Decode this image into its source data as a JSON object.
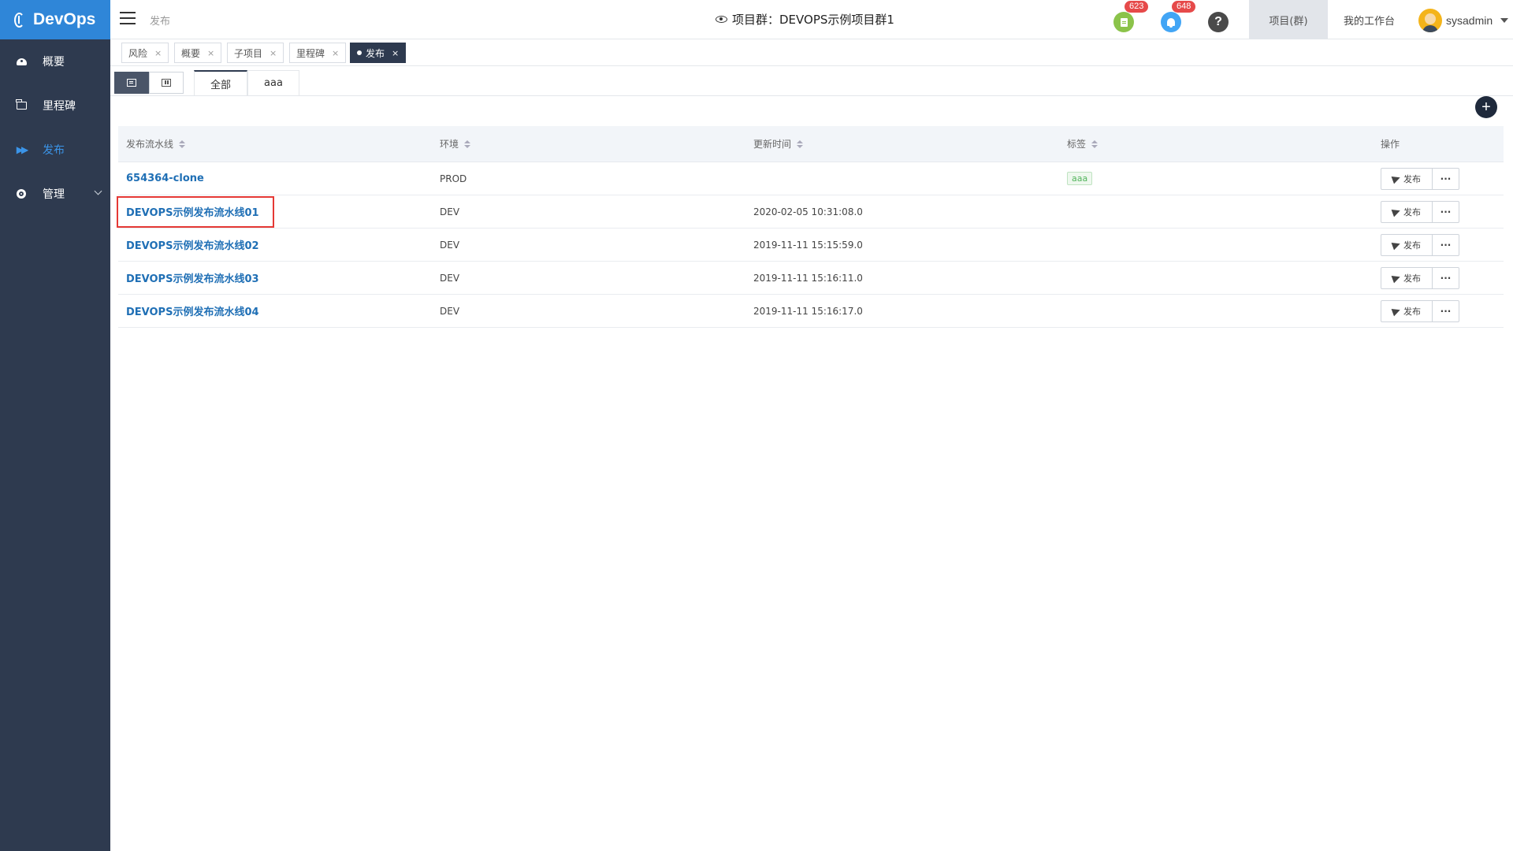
{
  "app": {
    "name": "DevOps"
  },
  "sidebar": {
    "items": [
      {
        "label": "概要",
        "icon": "dashboard-icon",
        "active": false
      },
      {
        "label": "里程碑",
        "icon": "folder-icon",
        "active": false
      },
      {
        "label": "发布",
        "icon": "fast-forward-icon",
        "active": true
      },
      {
        "label": "管理",
        "icon": "gear-icon",
        "active": false,
        "expandable": true
      }
    ]
  },
  "header": {
    "breadcrumb": "发布",
    "title": "项目群：DEVOPS示例项目群1",
    "doc_badge": "623",
    "bell_badge": "648",
    "help": "?",
    "project_group_label": "项目(群)",
    "workbench_label": "我的工作台",
    "user_name": "sysadmin"
  },
  "tabs": [
    {
      "label": "风险",
      "close": "×",
      "active": false
    },
    {
      "label": "概要",
      "close": "×",
      "active": false
    },
    {
      "label": "子项目",
      "close": "×",
      "active": false
    },
    {
      "label": "里程碑",
      "close": "×",
      "active": false
    },
    {
      "label": "发布",
      "close": "×",
      "active": true
    }
  ],
  "filter_tabs": [
    {
      "label": "全部",
      "active": true
    },
    {
      "label": "aaa",
      "active": false
    }
  ],
  "add_button": "+",
  "table": {
    "columns": [
      "发布流水线",
      "环境",
      "更新时间",
      "标签",
      "操作"
    ],
    "rows": [
      {
        "name": "654364-clone",
        "env": "PROD",
        "updated": "",
        "tag": "aaa"
      },
      {
        "name": "DEVOPS示例发布流水线01",
        "env": "DEV",
        "updated": "2020-02-05 10:31:08.0",
        "tag": ""
      },
      {
        "name": "DEVOPS示例发布流水线02",
        "env": "DEV",
        "updated": "2019-11-11 15:15:59.0",
        "tag": ""
      },
      {
        "name": "DEVOPS示例发布流水线03",
        "env": "DEV",
        "updated": "2019-11-11 15:16:11.0",
        "tag": ""
      },
      {
        "name": "DEVOPS示例发布流水线04",
        "env": "DEV",
        "updated": "2019-11-11 15:16:17.0",
        "tag": ""
      }
    ],
    "action_publish": "发布",
    "action_more": "···"
  },
  "colors": {
    "sidebar_bg": "#2e3a4f",
    "logo_bg": "#2f86d8",
    "active_nav": "#3b94e8",
    "link": "#1f6fb5",
    "highlight_box": "#e53935",
    "badge": "#e64a4a"
  }
}
